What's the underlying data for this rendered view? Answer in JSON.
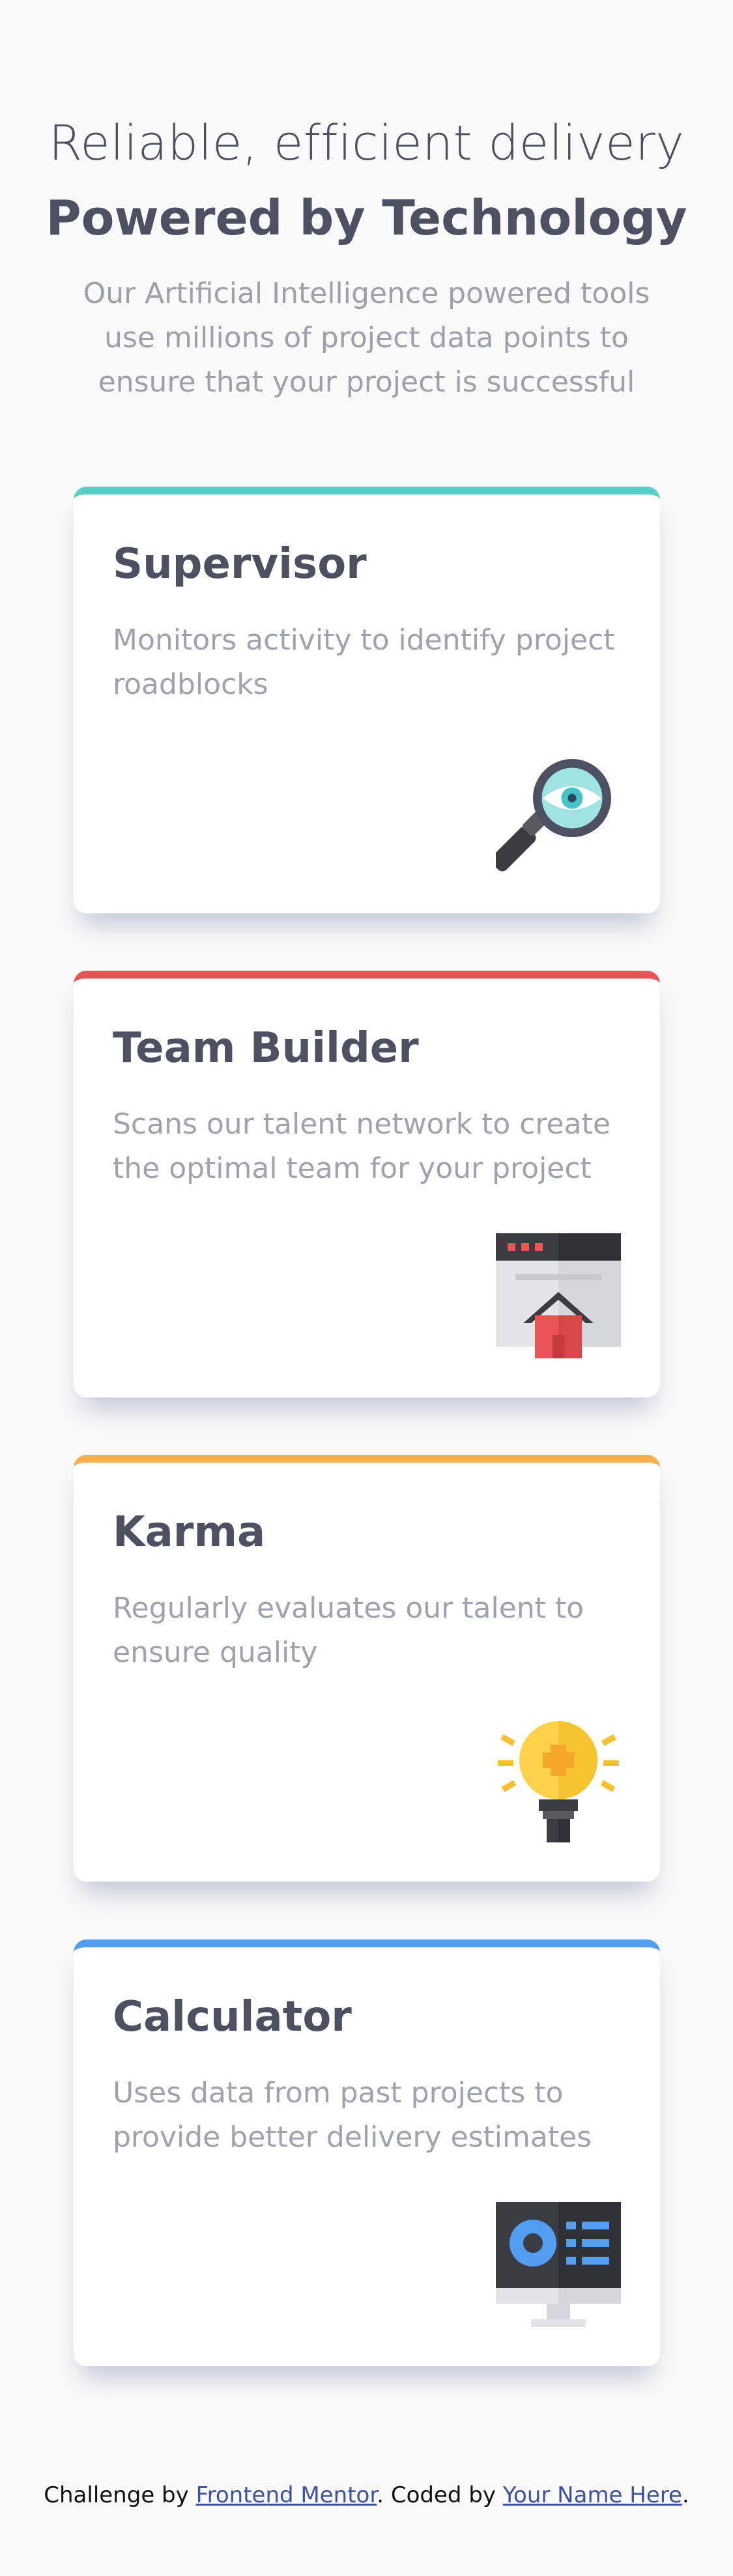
{
  "header": {
    "line1": "Reliable, efficient delivery",
    "line2": "Powered by Technology",
    "subtitle": "Our Artificial Intelligence powered tools use millions of project data points to ensure that your project is successful"
  },
  "cards": [
    {
      "title": "Supervisor",
      "description": "Monitors activity to identify project roadblocks",
      "icon": "magnifier-eye-icon",
      "accent": "#55d0c7"
    },
    {
      "title": "Team Builder",
      "description": "Scans our talent network to create the optimal team for your project",
      "icon": "browser-house-icon",
      "accent": "#ea5454"
    },
    {
      "title": "Karma",
      "description": "Regularly evaluates our talent to ensure quality",
      "icon": "lightbulb-icon",
      "accent": "#fcaf4a"
    },
    {
      "title": "Calculator",
      "description": "Uses data from past projects to provide better delivery estimates",
      "icon": "monitor-calculator-icon",
      "accent": "#549ef2"
    }
  ],
  "footer": {
    "prefix": "Challenge by ",
    "link1": "Frontend Mentor",
    "middle": ". Coded by ",
    "link2": "Your Name Here",
    "suffix": "."
  }
}
